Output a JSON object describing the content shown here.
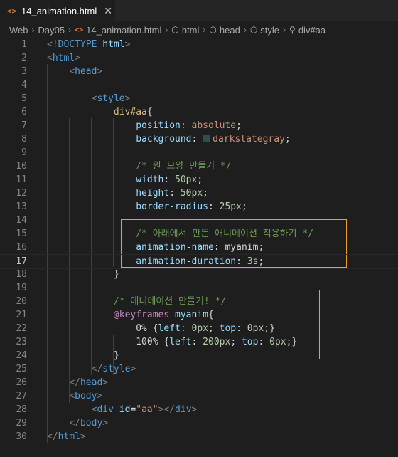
{
  "tab": {
    "icon": "<>",
    "filename": "14_animation.html",
    "close": "✕"
  },
  "breadcrumb": [
    "Web",
    "Day05",
    "14_animation.html",
    "html",
    "head",
    "style",
    "div#aa"
  ],
  "lines": [
    {
      "n": "1",
      "tokens": [
        {
          "t": "<!",
          "c": "p"
        },
        {
          "t": "DOCTYPE",
          "c": "t"
        },
        {
          "t": " html",
          "c": "a"
        },
        {
          "t": ">",
          "c": "p"
        }
      ]
    },
    {
      "n": "2",
      "tokens": [
        {
          "t": "<",
          "c": "p"
        },
        {
          "t": "html",
          "c": "t"
        },
        {
          "t": ">",
          "c": "p"
        }
      ]
    },
    {
      "n": "3",
      "tokens": [
        {
          "t": "    ",
          "c": "w"
        },
        {
          "t": "<",
          "c": "p"
        },
        {
          "t": "head",
          "c": "t"
        },
        {
          "t": ">",
          "c": "p"
        }
      ]
    },
    {
      "n": "4",
      "tokens": []
    },
    {
      "n": "5",
      "tokens": [
        {
          "t": "        ",
          "c": "w"
        },
        {
          "t": "<",
          "c": "p"
        },
        {
          "t": "style",
          "c": "t"
        },
        {
          "t": ">",
          "c": "p"
        }
      ]
    },
    {
      "n": "6",
      "tokens": [
        {
          "t": "            ",
          "c": "w"
        },
        {
          "t": "div#aa",
          "c": "s"
        },
        {
          "t": "{",
          "c": "w"
        }
      ]
    },
    {
      "n": "7",
      "tokens": [
        {
          "t": "                ",
          "c": "w"
        },
        {
          "t": "position",
          "c": "a"
        },
        {
          "t": ": ",
          "c": "w"
        },
        {
          "t": "absolute",
          "c": "v"
        },
        {
          "t": ";",
          "c": "w"
        }
      ]
    },
    {
      "n": "8",
      "tokens": [
        {
          "t": "                ",
          "c": "w"
        },
        {
          "t": "background",
          "c": "a"
        },
        {
          "t": ": ",
          "c": "w"
        },
        {
          "t": "",
          "c": "swatch"
        },
        {
          "t": "darkslategray",
          "c": "v"
        },
        {
          "t": ";",
          "c": "w"
        }
      ]
    },
    {
      "n": "9",
      "tokens": []
    },
    {
      "n": "10",
      "tokens": [
        {
          "t": "                ",
          "c": "w"
        },
        {
          "t": "/* 원 모양 만들기 */",
          "c": "c"
        }
      ]
    },
    {
      "n": "11",
      "tokens": [
        {
          "t": "                ",
          "c": "w"
        },
        {
          "t": "width",
          "c": "a"
        },
        {
          "t": ": ",
          "c": "w"
        },
        {
          "t": "50px",
          "c": "n"
        },
        {
          "t": ";",
          "c": "w"
        }
      ]
    },
    {
      "n": "12",
      "tokens": [
        {
          "t": "                ",
          "c": "w"
        },
        {
          "t": "height",
          "c": "a"
        },
        {
          "t": ": ",
          "c": "w"
        },
        {
          "t": "50px",
          "c": "n"
        },
        {
          "t": ";",
          "c": "w"
        }
      ]
    },
    {
      "n": "13",
      "tokens": [
        {
          "t": "                ",
          "c": "w"
        },
        {
          "t": "border-radius",
          "c": "a"
        },
        {
          "t": ": ",
          "c": "w"
        },
        {
          "t": "25px",
          "c": "n"
        },
        {
          "t": ";",
          "c": "w"
        }
      ]
    },
    {
      "n": "14",
      "tokens": []
    },
    {
      "n": "15",
      "tokens": [
        {
          "t": "                ",
          "c": "w"
        },
        {
          "t": "/* 아래에서 만든 애니메이션 적용하기 */",
          "c": "c"
        }
      ]
    },
    {
      "n": "16",
      "tokens": [
        {
          "t": "                ",
          "c": "w"
        },
        {
          "t": "animation-name",
          "c": "a"
        },
        {
          "t": ": ",
          "c": "w"
        },
        {
          "t": "myanim",
          "c": "w"
        },
        {
          "t": ";",
          "c": "w"
        }
      ]
    },
    {
      "n": "17",
      "tokens": [
        {
          "t": "                ",
          "c": "w"
        },
        {
          "t": "animation-duration",
          "c": "a"
        },
        {
          "t": ": ",
          "c": "w"
        },
        {
          "t": "3s",
          "c": "n"
        },
        {
          "t": ";",
          "c": "w"
        }
      ]
    },
    {
      "n": "18",
      "tokens": [
        {
          "t": "            ",
          "c": "w"
        },
        {
          "t": "}",
          "c": "w"
        }
      ]
    },
    {
      "n": "19",
      "tokens": []
    },
    {
      "n": "20",
      "tokens": [
        {
          "t": "            ",
          "c": "w"
        },
        {
          "t": "/* 애니메이션 만들기! */",
          "c": "c"
        }
      ]
    },
    {
      "n": "21",
      "tokens": [
        {
          "t": "            ",
          "c": "w"
        },
        {
          "t": "@keyframes",
          "c": "k"
        },
        {
          "t": " ",
          "c": "w"
        },
        {
          "t": "myanim",
          "c": "a"
        },
        {
          "t": "{",
          "c": "w"
        }
      ]
    },
    {
      "n": "22",
      "tokens": [
        {
          "t": "                ",
          "c": "w"
        },
        {
          "t": "0%",
          "c": "w"
        },
        {
          "t": " {",
          "c": "w"
        },
        {
          "t": "left",
          "c": "a"
        },
        {
          "t": ": ",
          "c": "w"
        },
        {
          "t": "0px",
          "c": "n"
        },
        {
          "t": "; ",
          "c": "w"
        },
        {
          "t": "top",
          "c": "a"
        },
        {
          "t": ": ",
          "c": "w"
        },
        {
          "t": "0px",
          "c": "n"
        },
        {
          "t": ";}",
          "c": "w"
        }
      ]
    },
    {
      "n": "23",
      "tokens": [
        {
          "t": "                ",
          "c": "w"
        },
        {
          "t": "100%",
          "c": "w"
        },
        {
          "t": " {",
          "c": "w"
        },
        {
          "t": "left",
          "c": "a"
        },
        {
          "t": ": ",
          "c": "w"
        },
        {
          "t": "200px",
          "c": "n"
        },
        {
          "t": "; ",
          "c": "w"
        },
        {
          "t": "top",
          "c": "a"
        },
        {
          "t": ": ",
          "c": "w"
        },
        {
          "t": "0px",
          "c": "n"
        },
        {
          "t": ";}",
          "c": "w"
        }
      ]
    },
    {
      "n": "24",
      "tokens": [
        {
          "t": "            ",
          "c": "w"
        },
        {
          "t": "}",
          "c": "w"
        }
      ]
    },
    {
      "n": "25",
      "tokens": [
        {
          "t": "        ",
          "c": "w"
        },
        {
          "t": "</",
          "c": "p"
        },
        {
          "t": "style",
          "c": "t"
        },
        {
          "t": ">",
          "c": "p"
        }
      ]
    },
    {
      "n": "26",
      "tokens": [
        {
          "t": "    ",
          "c": "w"
        },
        {
          "t": "</",
          "c": "p"
        },
        {
          "t": "head",
          "c": "t"
        },
        {
          "t": ">",
          "c": "p"
        }
      ]
    },
    {
      "n": "27",
      "tokens": [
        {
          "t": "    ",
          "c": "w"
        },
        {
          "t": "<",
          "c": "p"
        },
        {
          "t": "body",
          "c": "t"
        },
        {
          "t": ">",
          "c": "p"
        }
      ]
    },
    {
      "n": "28",
      "tokens": [
        {
          "t": "        ",
          "c": "w"
        },
        {
          "t": "<",
          "c": "p"
        },
        {
          "t": "div",
          "c": "t"
        },
        {
          "t": " id",
          "c": "a"
        },
        {
          "t": "=",
          "c": "w"
        },
        {
          "t": "\"aa\"",
          "c": "v"
        },
        {
          "t": "></",
          "c": "p"
        },
        {
          "t": "div",
          "c": "t"
        },
        {
          "t": ">",
          "c": "p"
        }
      ]
    },
    {
      "n": "29",
      "tokens": [
        {
          "t": "    ",
          "c": "w"
        },
        {
          "t": "</",
          "c": "p"
        },
        {
          "t": "body",
          "c": "t"
        },
        {
          "t": ">",
          "c": "p"
        }
      ]
    },
    {
      "n": "30",
      "tokens": [
        {
          "t": "</",
          "c": "p"
        },
        {
          "t": "html",
          "c": "t"
        },
        {
          "t": ">",
          "c": "p"
        }
      ]
    }
  ],
  "current_line": "17",
  "highlight_color": "#f0a030"
}
